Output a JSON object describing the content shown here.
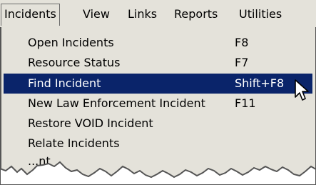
{
  "menubar": {
    "items": [
      {
        "label": "Incidents",
        "active": true
      },
      {
        "label": "View"
      },
      {
        "label": "Links"
      },
      {
        "label": "Reports"
      },
      {
        "label": "Utilities"
      }
    ]
  },
  "menu": {
    "items": [
      {
        "label": "Open Incidents",
        "shortcut": "F8"
      },
      {
        "label": "Resource Status",
        "shortcut": "F7"
      },
      {
        "label": "Find Incident",
        "shortcut": "Shift+F8",
        "highlighted": true
      },
      {
        "label": "New Law Enforcement Incident",
        "shortcut": "F11"
      },
      {
        "label": "Restore VOID Incident",
        "shortcut": ""
      },
      {
        "label": "Relate Incidents",
        "shortcut": ""
      },
      {
        "label": "...nt",
        "shortcut": ""
      }
    ]
  },
  "colors": {
    "menu_background": "#e4e2da",
    "highlight": "#0a246a",
    "highlight_text": "#ffffff"
  },
  "icons": {
    "cursor": "mouse-pointer-icon"
  }
}
